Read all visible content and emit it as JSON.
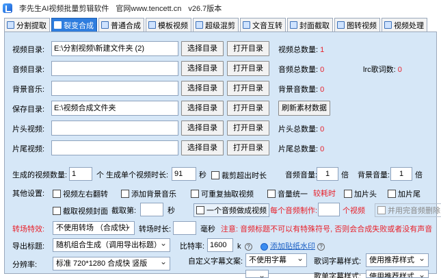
{
  "titlebar": {
    "app_name": "李先生AI视频批量剪辑软件",
    "website": "官网www.tencett.cn",
    "version": "v26.7版本"
  },
  "tabs": [
    {
      "label": "分割提取"
    },
    {
      "label": "裂变合成"
    },
    {
      "label": "普通合成"
    },
    {
      "label": "模板视频"
    },
    {
      "label": "超级混剪"
    },
    {
      "label": "文音互转"
    },
    {
      "label": "封面截取"
    },
    {
      "label": "图转视频"
    },
    {
      "label": "视频处理"
    }
  ],
  "rows": {
    "video_dir": {
      "label": "视频目录:",
      "value": "E:\\分割视频\\新建文件夹 (2)"
    },
    "audio_dir": {
      "label": "音频目录:",
      "value": ""
    },
    "bgm": {
      "label": "背景音乐:",
      "value": ""
    },
    "save_dir": {
      "label": "保存目录:",
      "value": "E:\\视频合成文件夹"
    },
    "intro": {
      "label": "片头视频:",
      "value": ""
    },
    "outro": {
      "label": "片尾视频:",
      "value": ""
    }
  },
  "buttons": {
    "select": "选择目录",
    "open": "打开目录",
    "refresh": "刷新素材数据"
  },
  "stats": {
    "video_total_label": "视频总数量:",
    "video_total": "1",
    "audio_total_label": "音频总数量:",
    "audio_total": "0",
    "lrc_label": "lrc歌词数:",
    "lrc_total": "0",
    "bgm_total_label": "背景音数量:",
    "bgm_total": "0",
    "intro_total_label": "片头总数量:",
    "intro_total": "0",
    "outro_total_label": "片尾总数量:",
    "outro_total": "0"
  },
  "gen": {
    "count_label": "生成的视频数量:",
    "count_value": "1",
    "count_unit": "个",
    "duration_label": "生成单个视频时长:",
    "duration_value": "91",
    "duration_unit": "秒",
    "trim_label": "裁剪超出时长",
    "audio_vol_label": "音频音量:",
    "audio_vol": "1",
    "audio_vol_unit": "倍",
    "bg_vol_label": "背景音量:",
    "bg_vol": "1",
    "bg_vol_unit": "倍"
  },
  "other": {
    "label": "其他设置:",
    "flip": "视频左右翻转",
    "add_bgm": "添加背景音乐",
    "repeat": "可重复抽取视频",
    "unify": "音量统一",
    "slow": "较耗时",
    "add_intro": "加片头",
    "add_outro": "加片尾",
    "cover": "截取视频封面",
    "cover_frame_label": "截取第:",
    "cover_frame_value": "",
    "cover_frame_unit": "秒",
    "one_audio": "一个音频做成视频",
    "per_audio_label": "每个音频制作:",
    "per_audio_value": "",
    "per_audio_unit": "个视频",
    "used_delete": "并用完音频删除"
  },
  "transition": {
    "label": "转场特效:",
    "value": "不使用转场 （合成快）",
    "duration_label": "转场时长:",
    "duration_value": "",
    "duration_unit": "毫秒",
    "note": "注意: 音频标题不可以有特殊符号, 否则会合成失败或者没有声音"
  },
  "export_title": {
    "label": "导出标题:",
    "value": "随机组合生成（调用导出标题）"
  },
  "bitrate": {
    "label": "比特率:",
    "value": "1600",
    "unit": "k",
    "watermark": "添加贴纸水印"
  },
  "resolution": {
    "label": "分辨率:",
    "value": "标准 720*1280 合成快 竖版"
  },
  "subtitle": {
    "label": "自定义字幕文案:",
    "value": "不使用字幕",
    "lyric_label": "歌词字幕样式:",
    "lyric_value": "使用推荐样式",
    "extra_label": "歌单字幕样式:",
    "extra_value": "使用推荐样式"
  },
  "colors": {
    "accent": "#2e7dde",
    "panel": "#d6e7f7",
    "red": "#e8202a"
  }
}
